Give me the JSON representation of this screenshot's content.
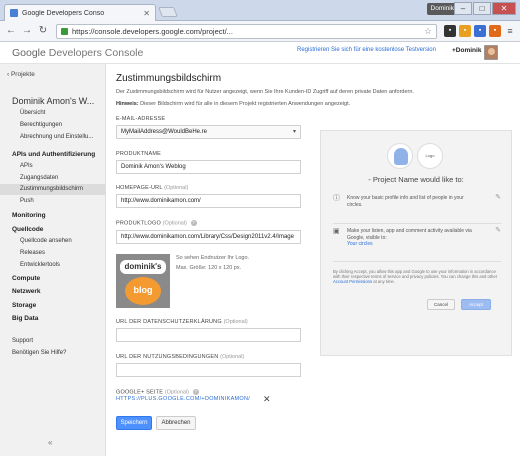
{
  "browser": {
    "tab_title": "Google Developers Conso",
    "user_chip": "Dominik",
    "url": "https://console.developers.google.com/project/..."
  },
  "header": {
    "logo_google": "Google",
    "logo_product": "Developers Console",
    "trial_link": "Registrieren Sie sich für eine kostenlose Testversion",
    "plus_user": "+Dominik"
  },
  "sidebar": {
    "back_label": "‹ Projekte",
    "project_name": "Dominik Amon's W...",
    "items": [
      {
        "label": "Übersicht"
      },
      {
        "label": "Berechtigungen"
      },
      {
        "label": "Abrechnung und Einstellu..."
      }
    ],
    "api_section": "APIs und Authentifizierung",
    "api_items": [
      {
        "label": "APIs"
      },
      {
        "label": "Zugangsdaten"
      },
      {
        "label": "Zustimmungsbildschirm"
      },
      {
        "label": "Push"
      }
    ],
    "monitoring": "Monitoring",
    "quellcode": "Quellcode",
    "quellcode_items": [
      {
        "label": "Quellcode ansehen"
      },
      {
        "label": "Releases"
      },
      {
        "label": "Entwicklertools"
      }
    ],
    "compute": "Compute",
    "netzwerk": "Netzwerk",
    "storage": "Storage",
    "bigdata": "Big Data",
    "support": "Support",
    "help": "Benötigen Sie Hilfe?",
    "collapse": "«"
  },
  "main": {
    "title": "Zustimmungsbildschirm",
    "description": "Der Zustimmungsbildschirm wird für Nutzer angezeigt, wenn Sie Ihre Kunden-ID Zugriff auf deren private Daten anfordern.",
    "hint_label": "Hinweis:",
    "hint_text": "Dieser Bildschirm wird für alle in diesem Projekt registrierten Anwendungen angezeigt.",
    "email_label": "E-MAIL-ADRESSE",
    "email_value": "MyMailAddress@WouldBeHe.re",
    "product_label": "PRODUKTNAME",
    "product_value": "Dominik Amon's Weblog",
    "homepage_label": "HOMEPAGE-URL",
    "homepage_optional": "(Optional)",
    "homepage_value": "http://www.dominikamon.com/",
    "logo_label": "PRODUKTLOGO",
    "logo_optional": "(Optional)",
    "logo_value": "http://www.dominikamon.com/Library/Css/Design2011v2.4/Image",
    "logo_bubble": "dominik's",
    "logo_heart": "blog",
    "logo_note1": "So sehen Endnutzer Ihr Logo.",
    "logo_note2": "Max. Größe: 120 x 120 px.",
    "privacy_label": "URL DER DATENSCHUTZERKLÄRUNG",
    "privacy_optional": "(Optional)",
    "privacy_value": "",
    "terms_label": "URL DER NUTZUNGSBEDINGUNGEN",
    "terms_optional": "(Optional)",
    "terms_value": "",
    "gplus_label": "GOOGLE+ SEITE",
    "gplus_optional": "(Optional)",
    "gplus_link": "HTTPS://PLUS.GOOGLE.COM/+DOMINIKAMON/",
    "gplus_remove": "✕",
    "save": "Speichern",
    "cancel": "Abbrechen"
  },
  "preview": {
    "logo_text": "Logo",
    "title": "- Project Name would like to:",
    "row1": "Know your basic profile info and list of people in your circles.",
    "row2a": "Make your listen, app and comment activity available via Google, visible to:",
    "row2b": "Your circles",
    "fine": "By clicking Accept, you allow this app and Google to use your information in accordance with their respective terms of service and privacy policies. You can change this and other",
    "fine_link": "Account Permissions",
    "fine_end": "at any time.",
    "cancel": "Cancel",
    "accept": "Accept"
  },
  "colors": {
    "accent": "#4d90fe",
    "link": "#2a6dd8",
    "sidebar_bg": "#f1f1f1"
  }
}
